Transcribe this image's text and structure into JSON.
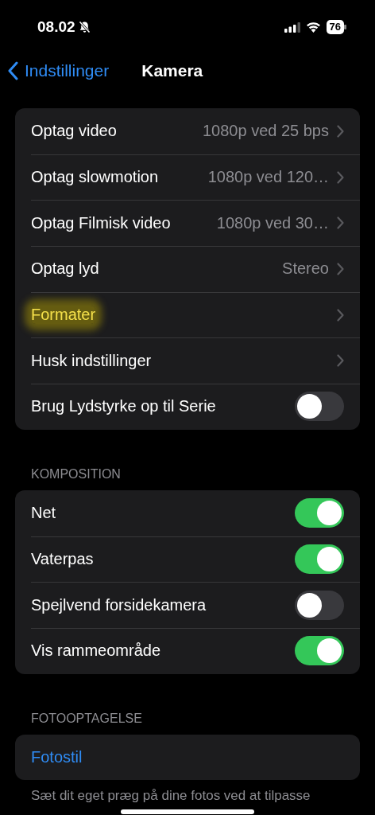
{
  "status_bar": {
    "time": "08.02",
    "battery": "76",
    "silent": true
  },
  "nav": {
    "back": "Indstillinger",
    "title": "Kamera"
  },
  "groups": [
    {
      "rows": [
        {
          "kind": "link",
          "label": "Optag video",
          "value": "1080p ved 25 bps"
        },
        {
          "kind": "link",
          "label": "Optag slowmotion",
          "value": "1080p ved 120…"
        },
        {
          "kind": "link",
          "label": "Optag Filmisk video",
          "value": "1080p ved 30…"
        },
        {
          "kind": "link",
          "label": "Optag lyd",
          "value": "Stereo"
        },
        {
          "kind": "link",
          "label": "Formater",
          "highlighted": true
        },
        {
          "kind": "link",
          "label": "Husk indstillinger"
        },
        {
          "kind": "toggle",
          "label": "Brug Lydstyrke op til Serie",
          "on": false
        }
      ]
    },
    {
      "header": "KOMPOSITION",
      "rows": [
        {
          "kind": "toggle",
          "label": "Net",
          "on": true
        },
        {
          "kind": "toggle",
          "label": "Vaterpas",
          "on": true
        },
        {
          "kind": "toggle",
          "label": "Spejlvend forsidekamera",
          "on": false
        },
        {
          "kind": "toggle",
          "label": "Vis rammeområde",
          "on": true
        }
      ]
    },
    {
      "header": "FOTOOPTAGELSE",
      "rows": [
        {
          "kind": "action",
          "label": "Fotostil"
        }
      ],
      "footer": "Sæt dit eget præg på dine fotos ved at tilpasse"
    }
  ]
}
